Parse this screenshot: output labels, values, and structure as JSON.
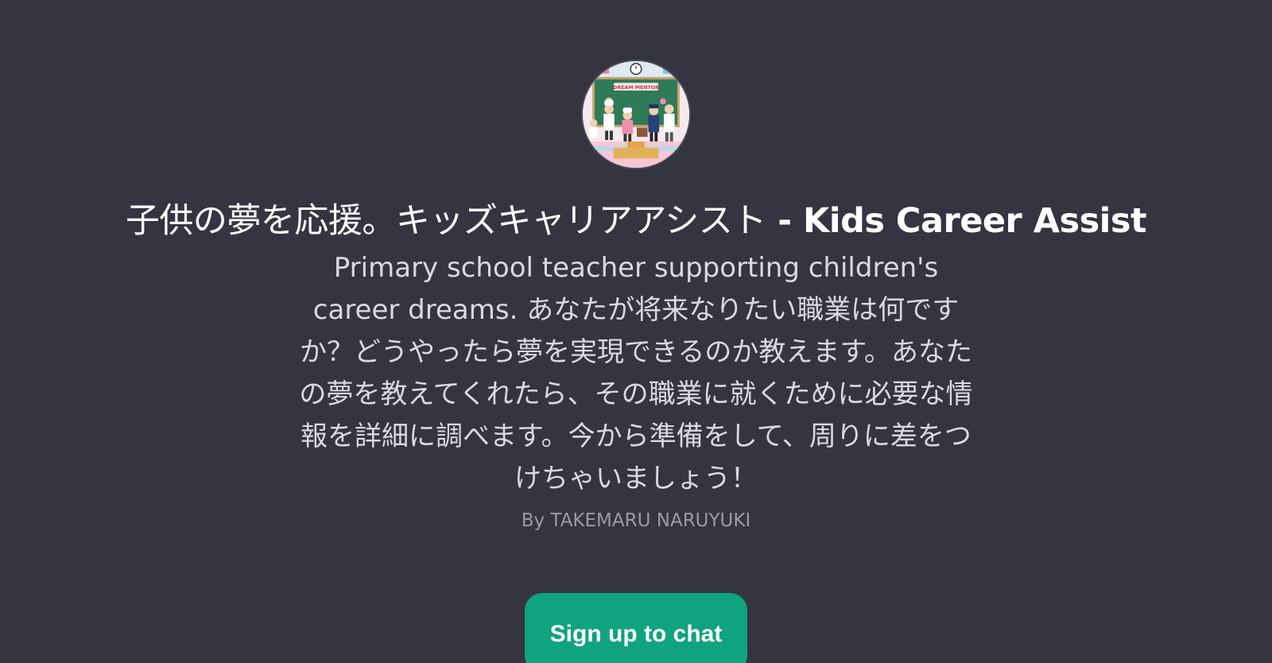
{
  "gpt": {
    "avatar_icon": "dream-mentor-classroom-illustration",
    "avatar_banner_text": "DREAM MENTOR",
    "title_jp": "子供の夢を応援。キッズキャリアアシスト",
    "title_sep": " - ",
    "title_en": "Kids Career Assist",
    "description": "Primary school teacher supporting children's career dreams. あなたが将来なりたい職業は何ですか？どうやったら夢を実現できるのか教えます。あなたの夢を教えてくれたら、その職業に就くために必要な情報を詳細に調べます。今から準備をして、周りに差をつけちゃいましょう！",
    "author": "By TAKEMARU NARUYUKI"
  },
  "cta": {
    "signup_label": "Sign up to chat"
  },
  "colors": {
    "background": "#343541",
    "button": "#10a37f",
    "title": "#ffffff",
    "description": "#d9d9e3",
    "author": "#9b9ba6"
  }
}
